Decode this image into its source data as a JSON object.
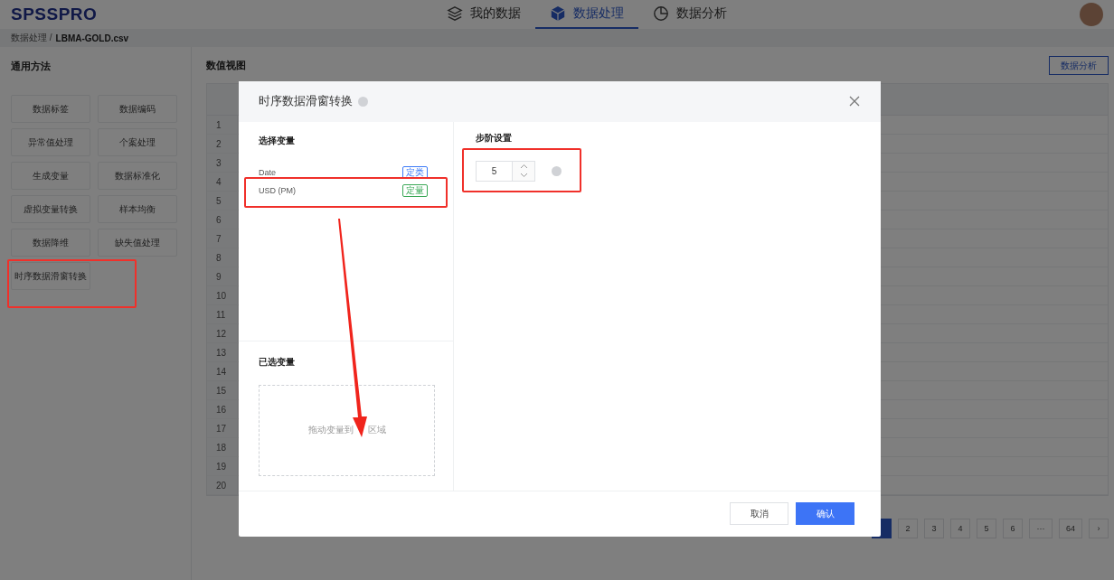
{
  "header": {
    "logo": "SPSSPRO",
    "nav": [
      {
        "label": "我的数据",
        "selected": false
      },
      {
        "label": "数据处理",
        "selected": true
      },
      {
        "label": "数据分析",
        "selected": false
      }
    ]
  },
  "breadcrumb": {
    "parent": "数据处理 /",
    "current": "LBMA-GOLD.csv"
  },
  "sidebar": {
    "title": "通用方法",
    "methods": [
      "数据标签",
      "数据编码",
      "异常值处理",
      "个案处理",
      "生成变量",
      "数据标准化",
      "虚拟变量转换",
      "样本均衡",
      "数据降维",
      "缺失值处理",
      "时序数据滑窗转换"
    ]
  },
  "main": {
    "title": "数值视图",
    "action": "数据分析",
    "row_numbers": [
      "1",
      "2",
      "3",
      "4",
      "5",
      "6",
      "7",
      "8",
      "9",
      "10",
      "11",
      "12",
      "13",
      "14",
      "15",
      "16",
      "17",
      "18",
      "19",
      "20"
    ],
    "pagination": [
      {
        "selected": true
      },
      {
        "label": "2",
        "selected": false
      },
      {
        "label": "3",
        "selected": false
      },
      {
        "label": "4",
        "selected": false
      },
      {
        "label": "5",
        "selected": false
      },
      {
        "label": "6",
        "selected": false
      },
      {
        "label": "···",
        "selected": false
      },
      {
        "label": "64",
        "selected": false
      },
      {
        "label": "›",
        "selected": false
      }
    ]
  },
  "dialog": {
    "title": "时序数据滑窗转换",
    "select_title": "选择变量",
    "variables": [
      {
        "name": "Date",
        "tag": "定类",
        "color": "#3d7bf7"
      },
      {
        "name": "USD (PM)",
        "tag": "定量",
        "color": "#3aa856"
      }
    ],
    "selected_title": "已选变量",
    "drop_hint": [
      "拖动变量到",
      "区域"
    ],
    "step_title": "步阶设置",
    "step_value": "5",
    "cancel": "取消",
    "confirm": "确认"
  }
}
